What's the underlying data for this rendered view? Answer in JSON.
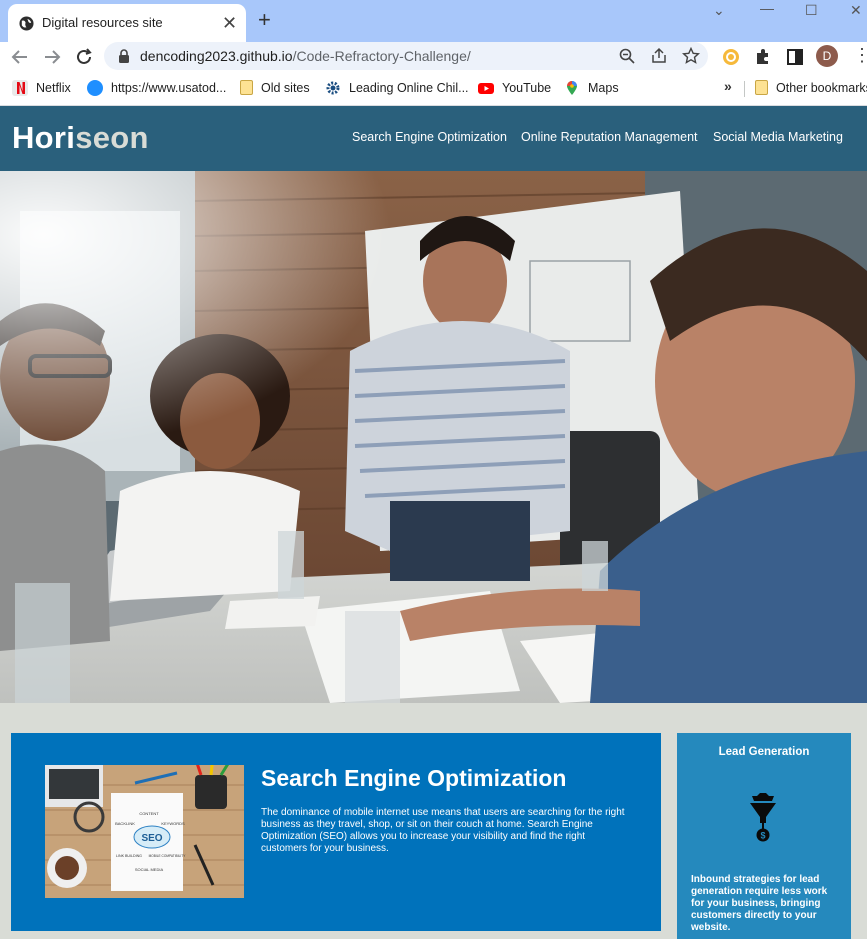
{
  "browser": {
    "tab_title": "Digital resources site",
    "url_host": "dencoding2023.github.io",
    "url_path": "/Code-Refractory-Challenge/",
    "bookmarks": [
      {
        "label": "Netflix",
        "icon": "netflix-icon"
      },
      {
        "label": "https://www.usatod...",
        "icon": "globe-icon"
      },
      {
        "label": "Old sites",
        "icon": "folder-icon"
      },
      {
        "label": "Leading Online Chil...",
        "icon": "gear-icon"
      },
      {
        "label": "YouTube",
        "icon": "youtube-icon"
      },
      {
        "label": "Maps",
        "icon": "maps-icon"
      }
    ],
    "other_bookmarks": "Other bookmarks",
    "avatar_letter": "D",
    "colors": {
      "tabbar": "#a8c7fa",
      "omnibox": "#edf2fa"
    }
  },
  "site": {
    "logo_main": "Hori",
    "logo_accent": "seon",
    "nav": [
      "Search Engine Optimization",
      "Online Reputation Management",
      "Social Media Marketing"
    ],
    "colors": {
      "header": "#2a607c",
      "content": "#0072bb",
      "benefit": "#2589bd",
      "page": "#d9dcd6"
    }
  },
  "content": {
    "seo": {
      "title": "Search Engine Optimization",
      "text": "The dominance of mobile internet use means that users are searching for the right business as they travel, shop, or sit on their couch at home. Search Engine Optimization (SEO) allows you to increase your visibility and find the right customers for your business.",
      "image_words": [
        "SEO",
        "CONTENT",
        "BACKLINK",
        "KEYWORDS",
        "LINK BUILDING",
        "MOBILE COMPATIBILITY",
        "SOCIAL MEDIA"
      ]
    }
  },
  "benefits": {
    "lead": {
      "title": "Lead Generation",
      "text": "Inbound strategies for lead generation require less work for your business, bringing customers directly to your website.",
      "icon": "lead-funnel-icon"
    }
  }
}
